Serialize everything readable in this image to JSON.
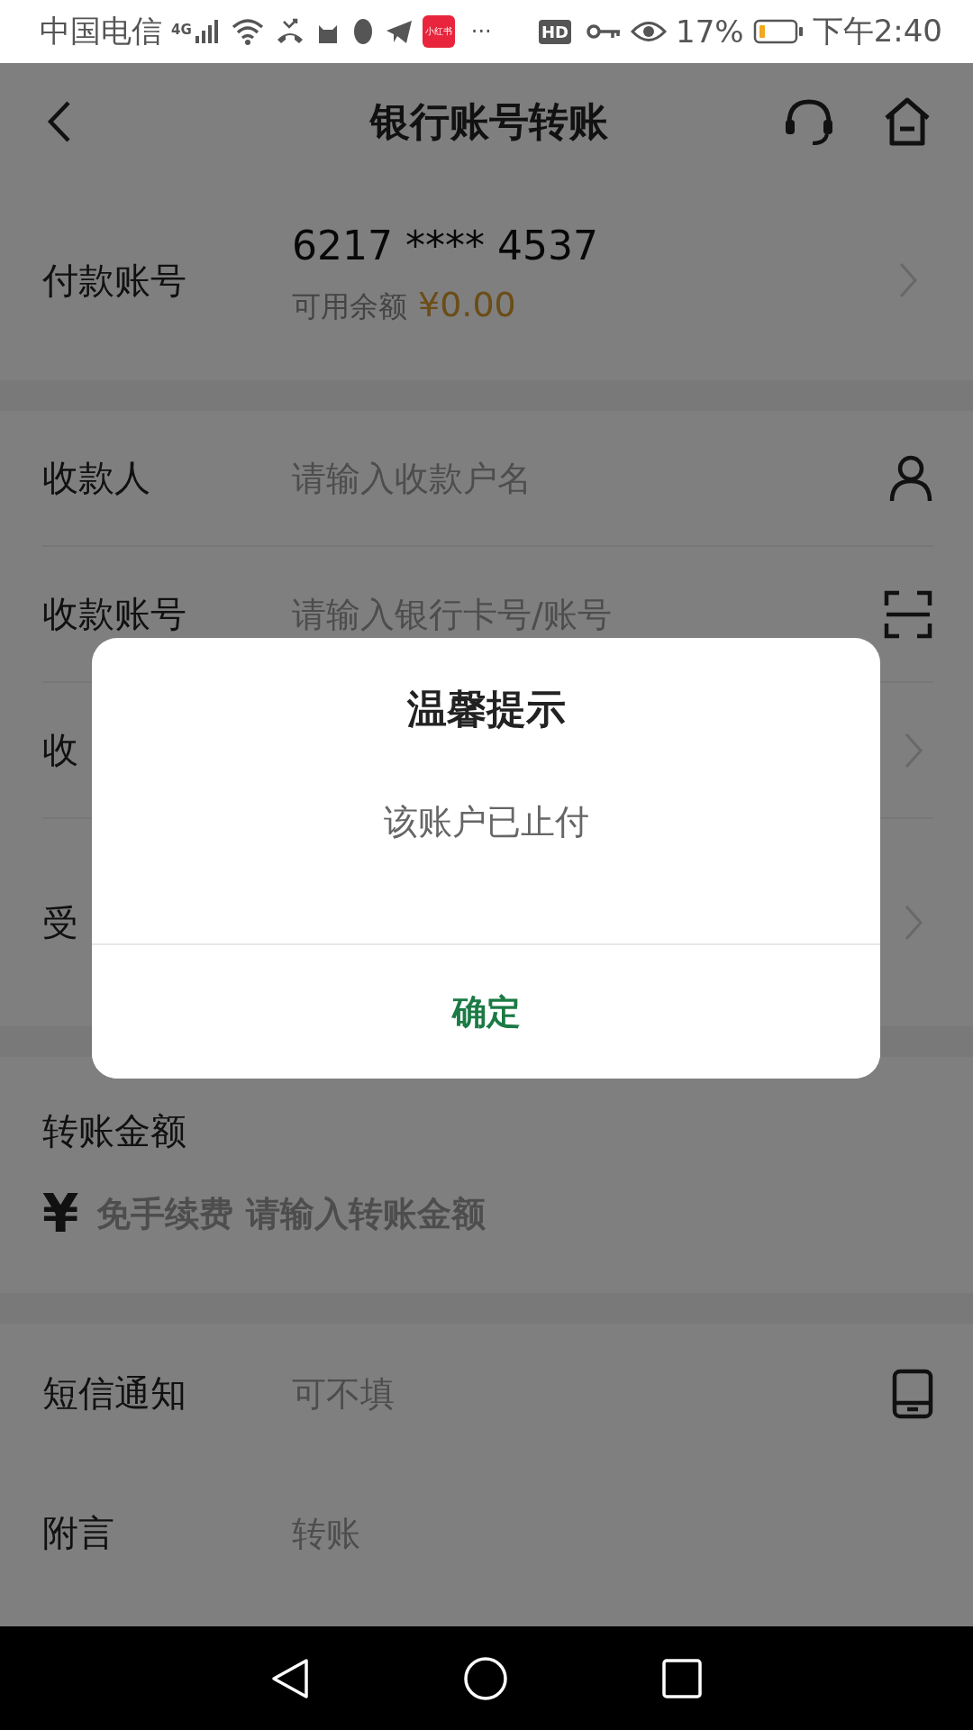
{
  "status_bar": {
    "carrier": "中国电信",
    "network": "4G",
    "app_badge": "小红书",
    "more": "···",
    "hd": "HD",
    "battery": "17%",
    "time": "下午2:40"
  },
  "header": {
    "title": "银行账号转账"
  },
  "payer": {
    "label": "付款账号",
    "account": "6217 **** 4537",
    "balance_label": "可用余额",
    "balance": "¥0.00"
  },
  "payee_rows": [
    {
      "label": "收款人",
      "placeholder": "请输入收款户名",
      "kind": "person"
    },
    {
      "label": "收款账号",
      "placeholder": "请输入银行卡号/账号",
      "kind": "scan"
    },
    {
      "label": "收",
      "kind": "chevron"
    },
    {
      "label": "受",
      "kind": "chevron"
    }
  ],
  "amount": {
    "label": "转账金额",
    "currency": "¥",
    "placeholder": "免手续费 请输入转账金额"
  },
  "extra_rows": [
    {
      "label": "短信通知",
      "placeholder": "可不填",
      "kind": "phone"
    },
    {
      "label": "附言",
      "placeholder": "转账",
      "kind": "none"
    }
  ],
  "dialog": {
    "title": "温馨提示",
    "message": "该账户已止付",
    "button": "确定"
  }
}
